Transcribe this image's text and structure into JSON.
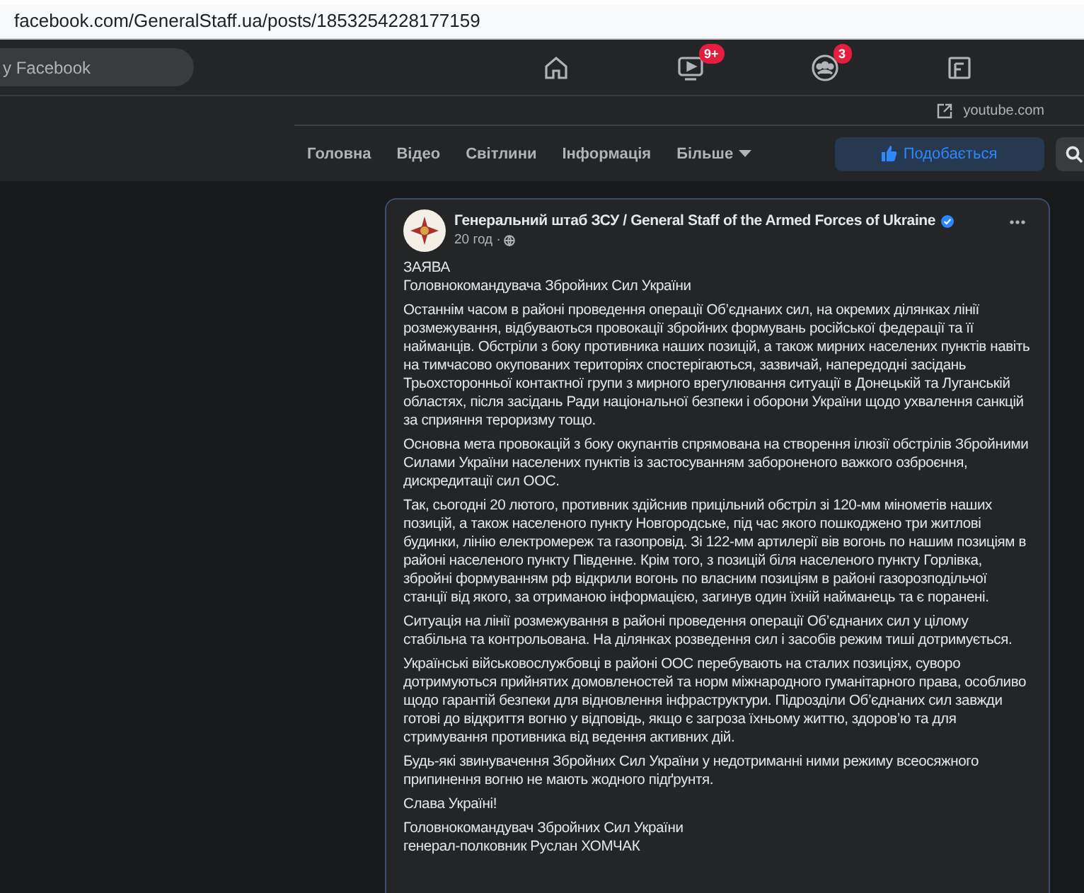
{
  "address_bar": {
    "url": "facebook.com/GeneralStaff.ua/posts/1853254228177159"
  },
  "top_bar": {
    "search": {
      "placeholder": "у Facebook"
    },
    "nav": [
      {
        "kind": "home"
      },
      {
        "kind": "video",
        "badge": "9+"
      },
      {
        "kind": "groups",
        "badge": "3"
      },
      {
        "kind": "gaming"
      }
    ]
  },
  "page_header": {
    "link": "youtube.com",
    "tabs": [
      {
        "label": "Головна"
      },
      {
        "label": "Відео"
      },
      {
        "label": "Світлини"
      },
      {
        "label": "Інформація"
      },
      {
        "label": "Більше",
        "dropdown": true
      }
    ],
    "like_button": "Подобається"
  },
  "post": {
    "author": "Генеральний штаб ЗСУ / General Staff of the Armed Forces of Ukraine",
    "verified": true,
    "time": "20 год ·",
    "paragraphs": [
      {
        "lines": [
          "ЗАЯВА",
          "Головнокомандувача Збройних Сил України"
        ]
      },
      {
        "lines": [
          "Останнім часом в районі проведення операції Об’єднаних сил, на окремих ділянках лінії розмежування, відбуваються провокації збройних формувань російської федерації та її найманців. Обстріли з боку противника наших позицій, а також мирних населених пунктів навіть на тимчасово окупованих територіях спостерігаються, зазвичай, напередодні засідань Трьохсторонньої контактної групи з мирного врегулювання ситуації в Донецькій та Луганській областях, після засідань Ради національної безпеки і оборони України щодо ухвалення санкцій за сприяння тероризму тощо."
        ]
      },
      {
        "lines": [
          "Основна мета провокацій з боку окупантів спрямована на створення ілюзії обстрілів Збройними Силами України населених пунктів із застосуванням забороненого важкого озброєння, дискредитації сил ООС."
        ]
      },
      {
        "lines": [
          "Так, сьогодні 20 лютого, противник здійснив прицільний обстріл зі 120-мм мінометів наших позицій, а також населеного пункту Новгородське, під час якого пошкоджено три житлові будинки, лінію електромереж та газопровід. Зі 122-мм артилерії вів вогонь по нашим позиціям в районі населеного пункту Південне. Крім того, з позицій біля населеного пункту Горлівка, збройні формуванням рф відкрили вогонь по власним позиціям в районі газорозподільчої станції від якого, за отриманою інформацією, загинув один їхній найманець та є поранені."
        ]
      },
      {
        "lines": [
          "Ситуація на лінії розмежування в районі проведення операції Об’єднаних сил у цілому стабільна та контрольована. На ділянках розведення сил і засобів режим тиші дотримується."
        ]
      },
      {
        "lines": [
          "Українські військовослужбовці в районі ООС перебувають на сталих позиціях, суворо дотримуються прийнятих домовленостей та норм міжнародного гуманітарного права, особливо щодо гарантій безпеки для відновлення інфраструктури. Підрозділи Об’єднаних сил завжди готові до відкриття вогню у відповідь, якщо є загроза їхньому життю, здоров’ю та для стримування противника від ведення активних дій."
        ]
      },
      {
        "lines": [
          "Будь-які звинувачення Збройних Сил України у недотриманні ними режиму всеосяжного припинення вогню не мають жодного підґрунтя."
        ]
      },
      {
        "lines": [
          "Слава Україні!"
        ]
      },
      {
        "lines": [
          "Головнокомандувач Збройних Сил України",
          "генерал-полковник Руслан ХОМЧАК"
        ]
      }
    ]
  }
}
